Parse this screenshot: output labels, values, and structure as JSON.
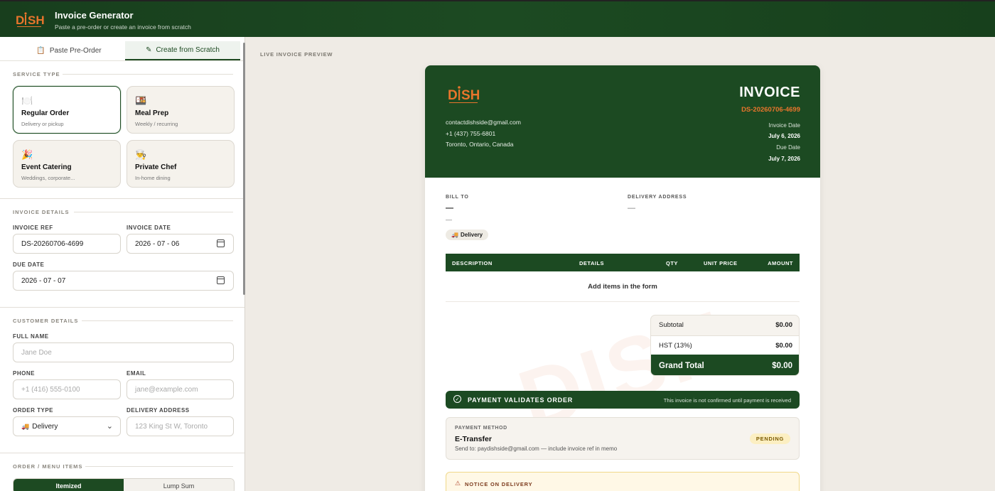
{
  "header": {
    "title": "Invoice Generator",
    "subtitle": "Paste a pre-order or create an invoice from scratch"
  },
  "tabs": [
    {
      "label": "Paste Pre-Order",
      "icon": "clipboard-icon"
    },
    {
      "label": "Create from Scratch",
      "icon": "edit-icon"
    }
  ],
  "service_type": {
    "heading": "SERVICE TYPE",
    "options": [
      {
        "name": "Regular Order",
        "desc": "Delivery or pickup",
        "emoji": "🍽️"
      },
      {
        "name": "Meal Prep",
        "desc": "Weekly / recurring",
        "emoji": "🍱"
      },
      {
        "name": "Event Catering",
        "desc": "Weddings, corporate...",
        "emoji": "🎉"
      },
      {
        "name": "Private Chef",
        "desc": "In-home dining",
        "emoji": "👨‍🍳"
      }
    ]
  },
  "invoice_details": {
    "heading": "INVOICE DETAILS",
    "ref_label": "INVOICE REF",
    "ref_value": "DS-20260706-4699",
    "date_label": "INVOICE DATE",
    "date_value": "2026 - 07 - 06",
    "due_label": "DUE DATE",
    "due_value": "2026 - 07 - 07"
  },
  "customer": {
    "heading": "CUSTOMER DETAILS",
    "name_label": "FULL NAME",
    "name_placeholder": "Jane Doe",
    "phone_label": "PHONE",
    "phone_placeholder": "+1 (416) 555-0100",
    "email_label": "EMAIL",
    "email_placeholder": "jane@example.com",
    "order_type_label": "ORDER TYPE",
    "order_type_value": "Delivery",
    "order_type_emoji": "🚚",
    "address_label": "DELIVERY ADDRESS",
    "address_placeholder": "123 King St W, Toronto"
  },
  "menu_items": {
    "heading": "ORDER / MENU ITEMS",
    "mode_itemized": "Itemized",
    "mode_lump": "Lump Sum"
  },
  "preview": {
    "label": "LIVE INVOICE PREVIEW",
    "invoice_word": "INVOICE",
    "invoice_number": "DS-20260706-4699",
    "invoice_date_label": "Invoice Date",
    "invoice_date": "July 6, 2026",
    "due_date_label": "Due Date",
    "due_date": "July 7, 2026",
    "email": "contactdishside@gmail.com",
    "phone": "+1 (437) 755-6801",
    "location": "Toronto, Ontario, Canada",
    "bill_to_label": "BILL TO",
    "bill_to_name": "—",
    "bill_to_sub": "—",
    "delivery_label": "DELIVERY ADDRESS",
    "delivery_value": "—",
    "pill": "Delivery",
    "pill_emoji": "🚚",
    "columns": [
      "DESCRIPTION",
      "DETAILS",
      "QTY",
      "UNIT PRICE",
      "AMOUNT"
    ],
    "empty": "Add items in the form",
    "subtotal_label": "Subtotal",
    "subtotal": "$0.00",
    "hst_label": "HST (13%)",
    "hst": "$0.00",
    "grand_label": "Grand Total",
    "grand": "$0.00",
    "pay_banner": "PAYMENT VALIDATES ORDER",
    "pay_banner_note": "This invoice is not confirmed until payment is received",
    "pay_method_label": "PAYMENT METHOD",
    "pay_method": "E-Transfer",
    "pay_send": "Send to: paydishside@gmail.com — include invoice ref in memo",
    "pay_status": "PENDING",
    "notice": "NOTICE ON DELIVERY"
  },
  "colors": {
    "brand_green": "#1c4a22",
    "accent_orange": "#e8752c"
  }
}
